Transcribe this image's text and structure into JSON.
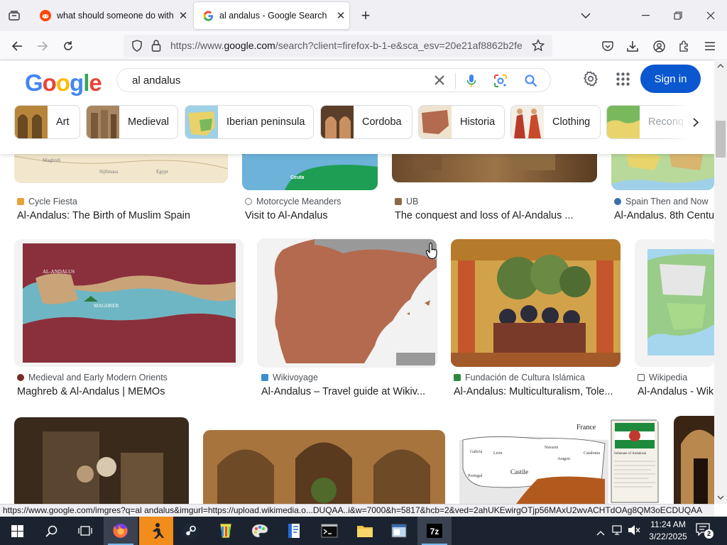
{
  "browser": {
    "tabs": [
      {
        "title": "what should someone do with",
        "active": false
      },
      {
        "title": "al andalus - Google Search",
        "active": true
      }
    ],
    "new_tab_label": "+",
    "url_prefix": "https://www.",
    "url_domain": "google.com",
    "url_rest": "/search?client=firefox-b-1-e&sca_esv=20e21af8862b2fe",
    "status_link": "https://www.google.com/imgres?q=al andalus&imgurl=https://upload.wikimedia.o...DUQAA..i&w=7000&h=5817&hcb=2&ved=2ahUKEwirgOTjp56MAxU2wvACHTdOAg8QM3oECDUQAA"
  },
  "google": {
    "logo": "Google",
    "query": "al andalus",
    "sign_in": "Sign in",
    "chips": [
      {
        "label": "Art"
      },
      {
        "label": "Medieval"
      },
      {
        "label": "Iberian peninsula"
      },
      {
        "label": "Cordoba"
      },
      {
        "label": "Historia"
      },
      {
        "label": "Clothing"
      },
      {
        "label": "Reconq"
      }
    ]
  },
  "results": {
    "row1": [
      {
        "source": "Cycle Fiesta",
        "title": "Al-Andalus: The Birth of Muslim Spain",
        "map_labels": [
          "Maghreb",
          "Sijilmasa",
          "Egypt"
        ]
      },
      {
        "source": "Motorcycle Meanders",
        "title": "Visit to Al-Andalus",
        "map_labels": [
          "Ceuta"
        ]
      },
      {
        "source": "UB",
        "title": "The conquest and loss of Al-Andalus ..."
      },
      {
        "source": "Spain Then and Now",
        "title": "Al-Andalus. 8th Centu"
      }
    ],
    "row2": [
      {
        "source": "Medieval and Early Modern Orients",
        "title": "Maghreb & Al-Andalus | MEMOs",
        "map_labels": [
          "AL-ANDALUS",
          "MAGHREB"
        ]
      },
      {
        "source": "Wikivoyage",
        "title": "Al-Andalus – Travel guide at Wikiv..."
      },
      {
        "source": "Fundación de Cultura Islámica",
        "title": "Al-Andalus: Multiculturalism, Tole..."
      },
      {
        "source": "Wikipedia",
        "title": "Al-Andalus - Wiki"
      }
    ],
    "row3_map_labels": [
      "France",
      "Galicia",
      "León",
      "Castile",
      "Navarre",
      "Aragon",
      "Catalonia",
      "Portugal",
      "Sultanate of Andalusia"
    ]
  },
  "taskbar": {
    "time": "11:24 AM",
    "date": "3/22/2025",
    "notification_count": "2"
  },
  "colors": {
    "signin_bg": "#0b57d0",
    "taskbar_bg": "#1c2330",
    "iberia_map": "#b46a4e"
  }
}
